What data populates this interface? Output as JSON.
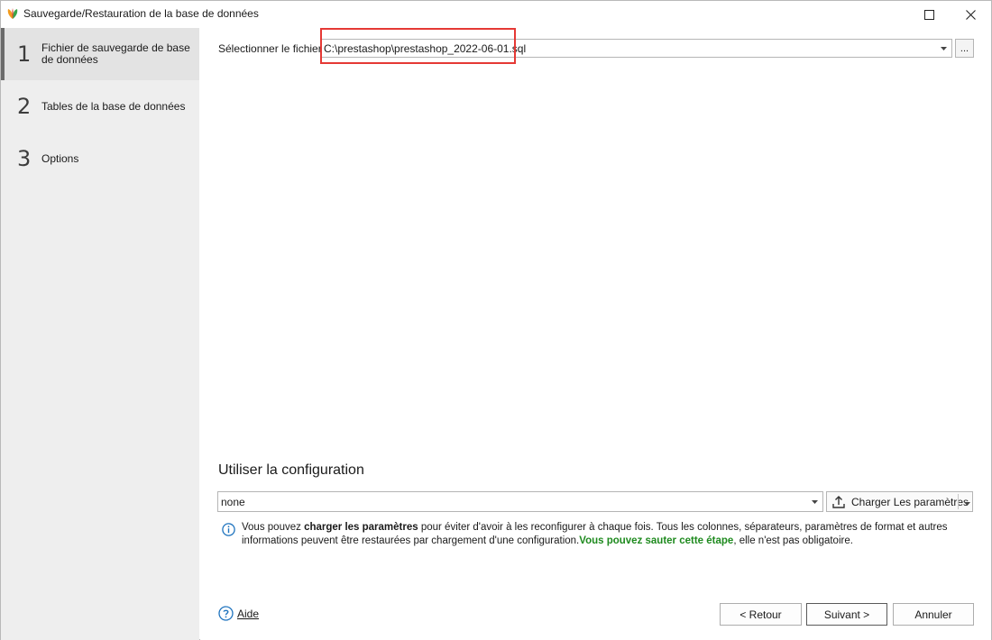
{
  "window": {
    "title": "Sauvegarde/Restauration de la base de données"
  },
  "sidebar": {
    "steps": [
      {
        "num": "1",
        "label": "Fichier de sauvegarde de base de données"
      },
      {
        "num": "2",
        "label": "Tables de la base de données"
      },
      {
        "num": "3",
        "label": "Options"
      }
    ]
  },
  "file": {
    "label": "Sélectionner le fichier",
    "value": "C:\\prestashop\\prestashop_2022-06-01.sql",
    "browse_label": "..."
  },
  "config": {
    "title": "Utiliser la configuration",
    "value": "none",
    "load_label": "Charger Les paramètres",
    "info_part1": "Vous pouvez ",
    "info_bold": "charger les paramètres",
    "info_part2": " pour éviter d'avoir à les reconfigurer à chaque fois. Tous les colonnes, séparateurs, paramètres de format et autres informations peuvent être restaurées par chargement d'une configuration.",
    "info_green": "Vous pouvez sauter cette étape",
    "info_part3": ", elle n'est pas obligatoire."
  },
  "footer": {
    "help_label": "Aide",
    "back_label": "< Retour",
    "next_label": "Suivant >",
    "cancel_label": "Annuler"
  },
  "colors": {
    "highlight": "#e53935",
    "info_green": "#1e8a1e",
    "info_blue": "#1e73be"
  }
}
